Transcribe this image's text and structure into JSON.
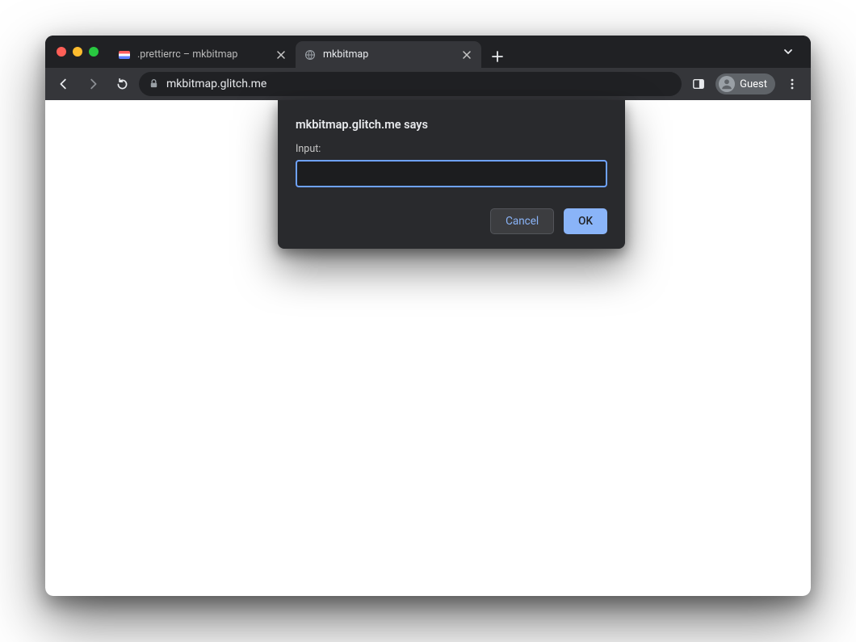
{
  "tabs": [
    {
      "title": ".prettierrc – mkbitmap",
      "active": false
    },
    {
      "title": "mkbitmap",
      "active": true
    }
  ],
  "addressbar": {
    "url": "mkbitmap.glitch.me"
  },
  "profile": {
    "label": "Guest"
  },
  "dialog": {
    "origin_says": "mkbitmap.glitch.me says",
    "label": "Input:",
    "value": "",
    "cancel": "Cancel",
    "ok": "OK"
  }
}
